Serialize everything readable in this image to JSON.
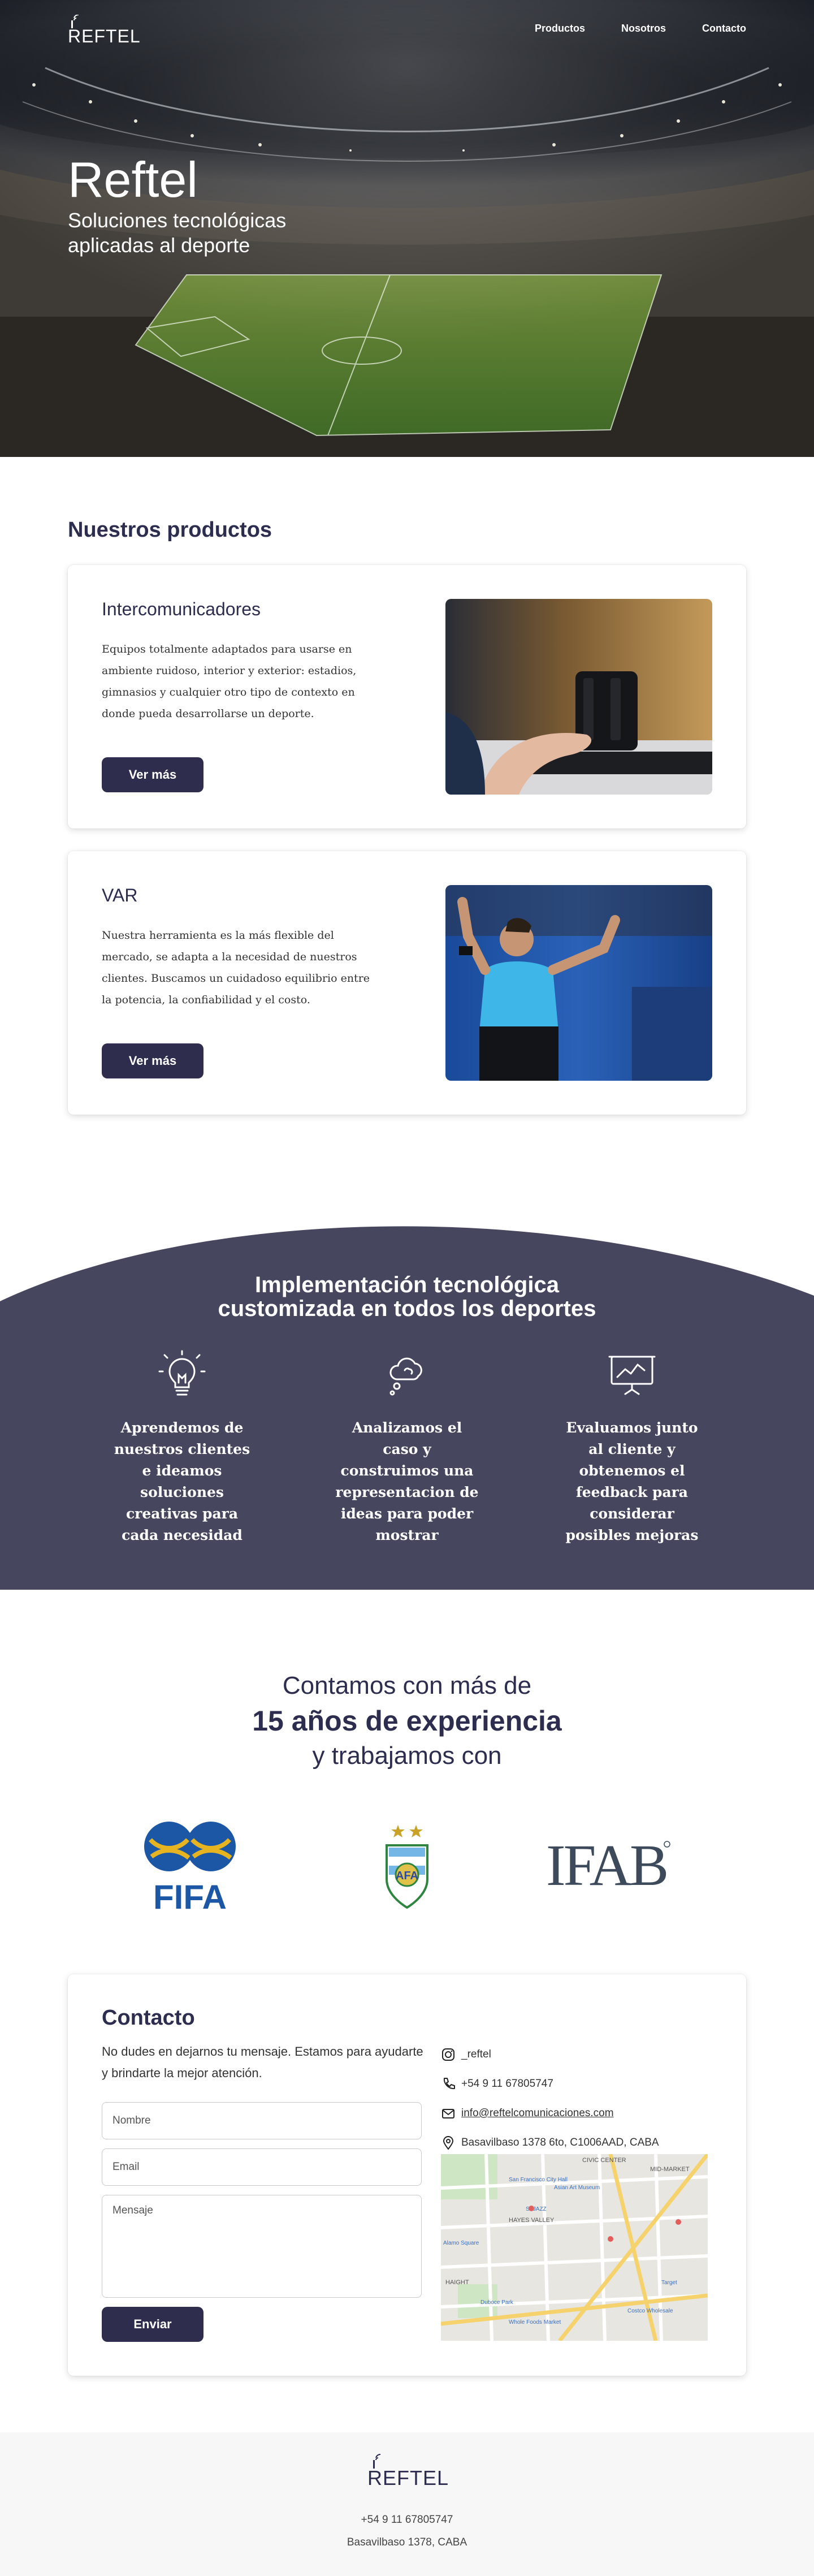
{
  "brand": {
    "logo_text": "REFTEL",
    "hero_title": "Reftel",
    "hero_subtitle": "Soluciones tecnológicas aplicadas al deporte"
  },
  "nav": {
    "items": [
      {
        "label": "Productos"
      },
      {
        "label": "Nosotros"
      },
      {
        "label": "Contacto"
      }
    ]
  },
  "products": {
    "title": "Nuestros productos",
    "items": [
      {
        "name": "Intercomunicadores",
        "description": "Equipos totalmente adaptados para usarse en ambiente ruidoso, interior y exterior: estadios, gimnasios y cualquier otro tipo de contexto en donde pueda desarrollarse un deporte.",
        "button": "Ver más"
      },
      {
        "name": "VAR",
        "description": "Nuestra herramienta es la más flexible del mercado, se adapta a la necesidad de nuestros clientes. Buscamos un cuidadoso equilibrio entre la potencia, la confiabilidad y el costo.",
        "button": "Ver más"
      }
    ]
  },
  "process": {
    "title_line1": "Implementación tecnológica",
    "title_line2": "customizada en todos los deportes",
    "steps": [
      {
        "icon": "lightbulb-icon",
        "text": "Aprendemos de nuestros clientes e ideamos soluciones creativas para cada necesidad"
      },
      {
        "icon": "cloud-thought-icon",
        "text": "Analizamos el caso y construimos una representacion de ideas para poder mostrar"
      },
      {
        "icon": "presentation-board-icon",
        "text": "Evaluamos junto al cliente y obtenemos el feedback para considerar posibles mejoras"
      }
    ]
  },
  "experience": {
    "line1": "Contamos con más de",
    "line2": "15 años de experiencia",
    "line3": "y trabajamos con",
    "partners": {
      "fifa": "FIFA",
      "afa": "AFA",
      "ifab": "IFAB"
    }
  },
  "contact": {
    "title": "Contacto",
    "intro": "No dudes en dejarnos tu mensaje. Estamos para ayudarte y brindarte la mejor atención.",
    "name_placeholder": "Nombre",
    "email_placeholder": "Email",
    "message_placeholder": "Mensaje",
    "send_label": "Enviar",
    "instagram": "_reftel",
    "phone": "+54 9 11 67805747",
    "email": "info@reftelcomunicaciones.com",
    "address": "Basavilbaso 1378 6to, C1006AAD, CABA",
    "map_labels": {
      "civic": "CIVIC CENTER",
      "market": "MID-MARKET",
      "hayes": "HAYES VALLEY",
      "haight": "HAIGHT",
      "hall": "San Francisco City Hall",
      "sfjazz": "SFJAZZ",
      "asian": "Asian Art Museum",
      "whole": "Whole Foods Market",
      "alamo": "Alamo Square",
      "duboce": "Duboce Park",
      "costco": "Costco Wholesale",
      "target": "Target"
    }
  },
  "footer": {
    "logo_text": "REFTEL",
    "phone": "+54 9 11 67805747",
    "address": "Basavilbaso 1378, CABA"
  },
  "colors": {
    "brand_dark": "#2c2d4f",
    "button": "#2e2d4d",
    "process_bg": "#47465f"
  }
}
